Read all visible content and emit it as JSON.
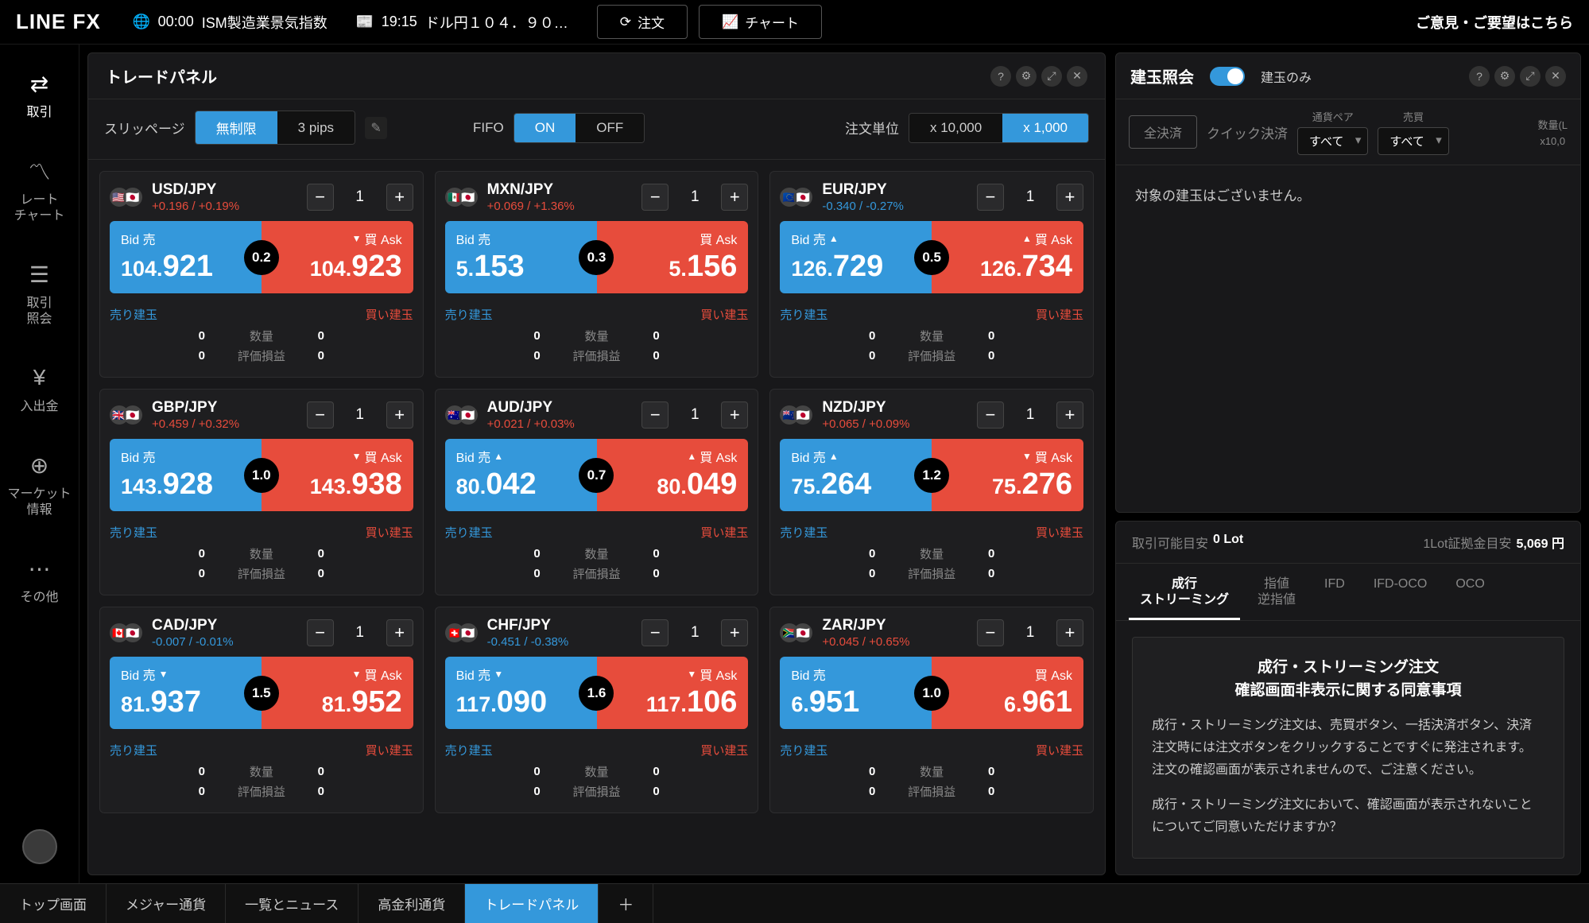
{
  "topbar": {
    "logo": "LINE FX",
    "ticker1_time": "00:00",
    "ticker1_label": "ISM製造業景気指数",
    "ticker2_time": "19:15",
    "ticker2_label": "ドル円１０４．９０…",
    "order_btn": "注文",
    "chart_btn": "チャート",
    "feedback": "ご意見・ご要望はこちら"
  },
  "sidebar": [
    {
      "label": "取引",
      "icon": "arrows"
    },
    {
      "label": "レート\nチャート",
      "icon": "pulse"
    },
    {
      "label": "取引\n照会",
      "icon": "list"
    },
    {
      "label": "入出金",
      "icon": "yen"
    },
    {
      "label": "マーケット\n情報",
      "icon": "globe"
    },
    {
      "label": "その他",
      "icon": "dots"
    }
  ],
  "trade_panel": {
    "title": "トレードパネル",
    "slippage_label": "スリッページ",
    "slippage_opts": [
      "無制限",
      "3 pips"
    ],
    "fifo_label": "FIFO",
    "fifo_opts": [
      "ON",
      "OFF"
    ],
    "unit_label": "注文単位",
    "unit_opts": [
      "x 10,000",
      "x 1,000"
    ]
  },
  "pairs": [
    {
      "name": "USD/JPY",
      "change": "+0.196 / +0.19%",
      "sign": "pos",
      "qty": "1",
      "bid": "104.",
      "bid_big": "921",
      "ask": "104.",
      "ask_big": "923",
      "spread": "0.2",
      "bid_arrow": "",
      "ask_arrow": "▼",
      "f1": "🇺🇸",
      "f2": "🇯🇵"
    },
    {
      "name": "MXN/JPY",
      "change": "+0.069 / +1.36%",
      "sign": "pos",
      "qty": "1",
      "bid": "5.",
      "bid_big": "153",
      "ask": "5.",
      "ask_big": "156",
      "spread": "0.3",
      "bid_arrow": "",
      "ask_arrow": "",
      "f1": "🇲🇽",
      "f2": "🇯🇵"
    },
    {
      "name": "EUR/JPY",
      "change": "-0.340 / -0.27%",
      "sign": "neg",
      "qty": "1",
      "bid": "126.",
      "bid_big": "729",
      "ask": "126.",
      "ask_big": "734",
      "spread": "0.5",
      "bid_arrow": "▲",
      "ask_arrow": "▲",
      "f1": "🇪🇺",
      "f2": "🇯🇵"
    },
    {
      "name": "GBP/JPY",
      "change": "+0.459 / +0.32%",
      "sign": "pos",
      "qty": "1",
      "bid": "143.",
      "bid_big": "928",
      "ask": "143.",
      "ask_big": "938",
      "spread": "1.0",
      "bid_arrow": "",
      "ask_arrow": "▼",
      "f1": "🇬🇧",
      "f2": "🇯🇵"
    },
    {
      "name": "AUD/JPY",
      "change": "+0.021 / +0.03%",
      "sign": "pos",
      "qty": "1",
      "bid": "80.",
      "bid_big": "042",
      "ask": "80.",
      "ask_big": "049",
      "spread": "0.7",
      "bid_arrow": "▲",
      "ask_arrow": "▲",
      "f1": "🇦🇺",
      "f2": "🇯🇵"
    },
    {
      "name": "NZD/JPY",
      "change": "+0.065 / +0.09%",
      "sign": "pos",
      "qty": "1",
      "bid": "75.",
      "bid_big": "264",
      "ask": "75.",
      "ask_big": "276",
      "spread": "1.2",
      "bid_arrow": "▲",
      "ask_arrow": "▼",
      "f1": "🇳🇿",
      "f2": "🇯🇵"
    },
    {
      "name": "CAD/JPY",
      "change": "-0.007 / -0.01%",
      "sign": "neg",
      "qty": "1",
      "bid": "81.",
      "bid_big": "937",
      "ask": "81.",
      "ask_big": "952",
      "spread": "1.5",
      "bid_arrow": "▼",
      "ask_arrow": "▼",
      "f1": "🇨🇦",
      "f2": "🇯🇵"
    },
    {
      "name": "CHF/JPY",
      "change": "-0.451 / -0.38%",
      "sign": "neg",
      "qty": "1",
      "bid": "117.",
      "bid_big": "090",
      "ask": "117.",
      "ask_big": "106",
      "spread": "1.6",
      "bid_arrow": "▼",
      "ask_arrow": "▼",
      "f1": "🇨🇭",
      "f2": "🇯🇵"
    },
    {
      "name": "ZAR/JPY",
      "change": "+0.045 / +0.65%",
      "sign": "pos",
      "qty": "1",
      "bid": "6.",
      "bid_big": "951",
      "ask": "6.",
      "ask_big": "961",
      "spread": "1.0",
      "bid_arrow": "",
      "ask_arrow": "",
      "f1": "🇿🇦",
      "f2": "🇯🇵"
    }
  ],
  "pair_labels": {
    "bid": "Bid 売",
    "ask": "買 Ask",
    "sell_pos": "売り建玉",
    "buy_pos": "買い建玉",
    "qty": "数量",
    "pl": "評価損益",
    "zero": "0"
  },
  "positions": {
    "title": "建玉照会",
    "toggle_label": "建玉のみ",
    "settle_all": "全決済",
    "quick_settle": "クイック決済",
    "pair_filter_label": "通貨ペア",
    "side_filter_label": "売買",
    "filter_all": "すべて",
    "qty_header": "数量(L",
    "qty_unit": "x10,0",
    "empty": "対象の建玉はございません。"
  },
  "order": {
    "margin_label": "取引可能目安",
    "margin_val": "0 Lot",
    "req_label": "1Lot証拠金目安",
    "req_val": "5,069 円",
    "tabs": [
      "成行\nストリーミング",
      "指値\n逆指値",
      "IFD",
      "IFD-OCO",
      "OCO"
    ],
    "disc_title": "成行・ストリーミング注文\n確認画面非表示に関する同意事項",
    "disc_p1": "成行・ストリーミング注文は、売買ボタン、一括決済ボタン、決済注文時には注文ボタンをクリックすることですぐに発注されます。\n注文の確認画面が表示されませんので、ご注意ください。",
    "disc_p2": "成行・ストリーミング注文において、確認画面が表示されないことについてご同意いただけますか？"
  },
  "bottom_tabs": [
    "トップ画面",
    "メジャー通貨",
    "一覧とニュース",
    "高金利通貨",
    "トレードパネル"
  ]
}
